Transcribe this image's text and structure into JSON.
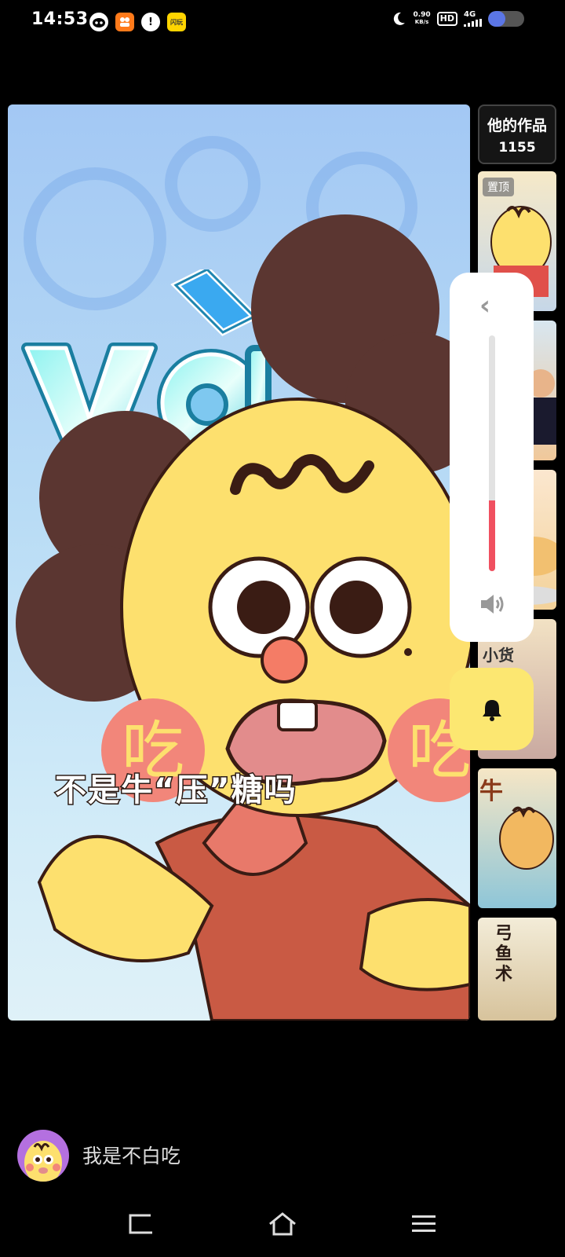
{
  "status_bar": {
    "time": "14:53",
    "network_speed_value": "0.90",
    "network_speed_unit": "KB/s",
    "hd_label": "HD",
    "signal_label": "4G",
    "notification_icons": [
      "cat-icon",
      "app-icon",
      "alert-icon",
      "flash-icon"
    ],
    "notification_icon_text": {
      "flash": "闪玩"
    },
    "battery_level_percent": 48
  },
  "video": {
    "pinyin_label": "yà",
    "subtitle": "不是牛“压”糖吗",
    "cheek_text": "吃"
  },
  "sidebar": {
    "works_title": "他的作品",
    "works_count": "1155",
    "thumbnails": [
      {
        "badge": "置顶",
        "text": ""
      },
      {
        "badge": "",
        "text": ""
      },
      {
        "badge": "",
        "text": ""
      },
      {
        "badge": "",
        "text": "小货"
      },
      {
        "badge": "",
        "text": "牛"
      },
      {
        "badge": "",
        "text": "弓鱼术"
      }
    ]
  },
  "volume": {
    "level_fraction": 0.3
  },
  "author": {
    "name": "我是不白吃"
  },
  "colors": {
    "accent_red": "#f05060",
    "bell_yellow": "#fce771",
    "avatar_purple": "#b470e0"
  }
}
